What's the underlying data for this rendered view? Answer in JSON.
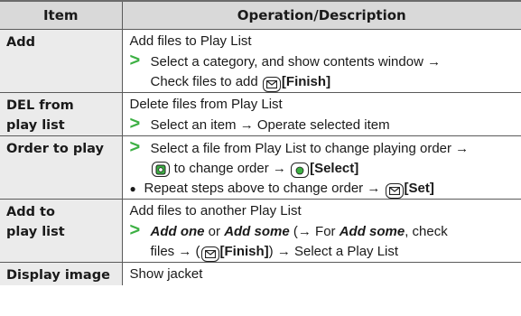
{
  "header": {
    "item": "Item",
    "operation": "Operation/Description"
  },
  "rows": [
    {
      "item_lines": [
        "Add"
      ],
      "desc_line": "Add files to Play List",
      "step1": "Select a category, and show contents window →",
      "step2_a": "Check files to add ",
      "step2_key": "[Finish]"
    },
    {
      "item_lines": [
        "DEL from",
        "play list"
      ],
      "desc_line": "Delete files from Play List",
      "step1": "Select an item → Operate selected item"
    },
    {
      "item_lines": [
        "Order to play"
      ],
      "step1": "Select a file from Play List to change playing order →",
      "step2_a": " to change order → ",
      "step2_key": "[Select]",
      "bullet_a": "Repeat steps above to change order → ",
      "bullet_key": "[Set]"
    },
    {
      "item_lines": [
        "Add to",
        "play list"
      ],
      "desc_line": "Add files to another Play List",
      "opt1": "Add one",
      "or": " or ",
      "opt2": "Add some",
      "paren_a": " (→ For ",
      "opt3": "Add some",
      "paren_b": ", check",
      "line2_a": "files → (",
      "line2_key": "[Finish]",
      "line2_b": ") → Select a Play List"
    },
    {
      "item_lines": [
        "Display image"
      ],
      "desc_line": "Show jacket"
    }
  ],
  "icons": {
    "arrow": "green-arrow-icon",
    "mail_key": "mail-key-icon",
    "dpad_key": "dpad-key-icon",
    "center_key": "center-key-icon",
    "accent_green": "#3cb043"
  }
}
